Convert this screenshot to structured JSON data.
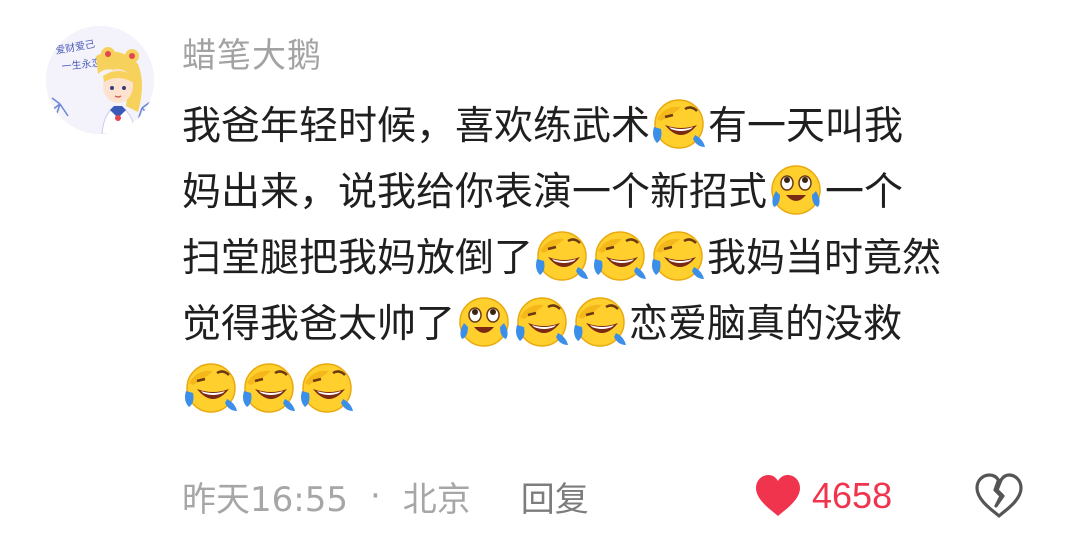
{
  "comment": {
    "username": "蜡笔大鹅",
    "avatar_icon": "anime-girl-avatar",
    "lines": [
      [
        {
          "t": "text",
          "v": "我爸年轻时候，喜欢练武术"
        },
        {
          "t": "emoji",
          "v": "laugh-cry-emoji"
        },
        {
          "t": "text",
          "v": "有一天叫我"
        }
      ],
      [
        {
          "t": "text",
          "v": "妈出来，说我给你表演一个新招式"
        },
        {
          "t": "emoji",
          "v": "tears-of-joy-emoji"
        },
        {
          "t": "text",
          "v": "一个"
        }
      ],
      [
        {
          "t": "text",
          "v": "扫堂腿把我妈放倒了"
        },
        {
          "t": "emoji",
          "v": "laugh-cry-emoji"
        },
        {
          "t": "emoji",
          "v": "laugh-cry-emoji"
        },
        {
          "t": "emoji",
          "v": "laugh-cry-emoji"
        },
        {
          "t": "text",
          "v": "我妈当时竟然"
        }
      ],
      [
        {
          "t": "text",
          "v": "觉得我爸太帅了"
        },
        {
          "t": "emoji",
          "v": "tears-of-joy-emoji"
        },
        {
          "t": "emoji",
          "v": "laugh-cry-emoji"
        },
        {
          "t": "emoji",
          "v": "laugh-cry-emoji"
        },
        {
          "t": "text",
          "v": "恋爱脑真的没救"
        }
      ],
      [
        {
          "t": "emoji",
          "v": "laugh-cry-emoji"
        },
        {
          "t": "emoji",
          "v": "laugh-cry-emoji"
        },
        {
          "t": "emoji",
          "v": "laugh-cry-emoji"
        }
      ]
    ],
    "time": "昨天16:55",
    "separator": "·",
    "location": "北京",
    "reply_label": "回复",
    "like_count": "4658",
    "like_icon": "heart-filled-icon",
    "dislike_icon": "broken-heart-icon"
  },
  "colors": {
    "username": "#a3a3a3",
    "meta": "#a6a6a6",
    "like": "#f0344d",
    "emoji_face": "#ffcf2e",
    "emoji_tear": "#3c8fe8"
  }
}
